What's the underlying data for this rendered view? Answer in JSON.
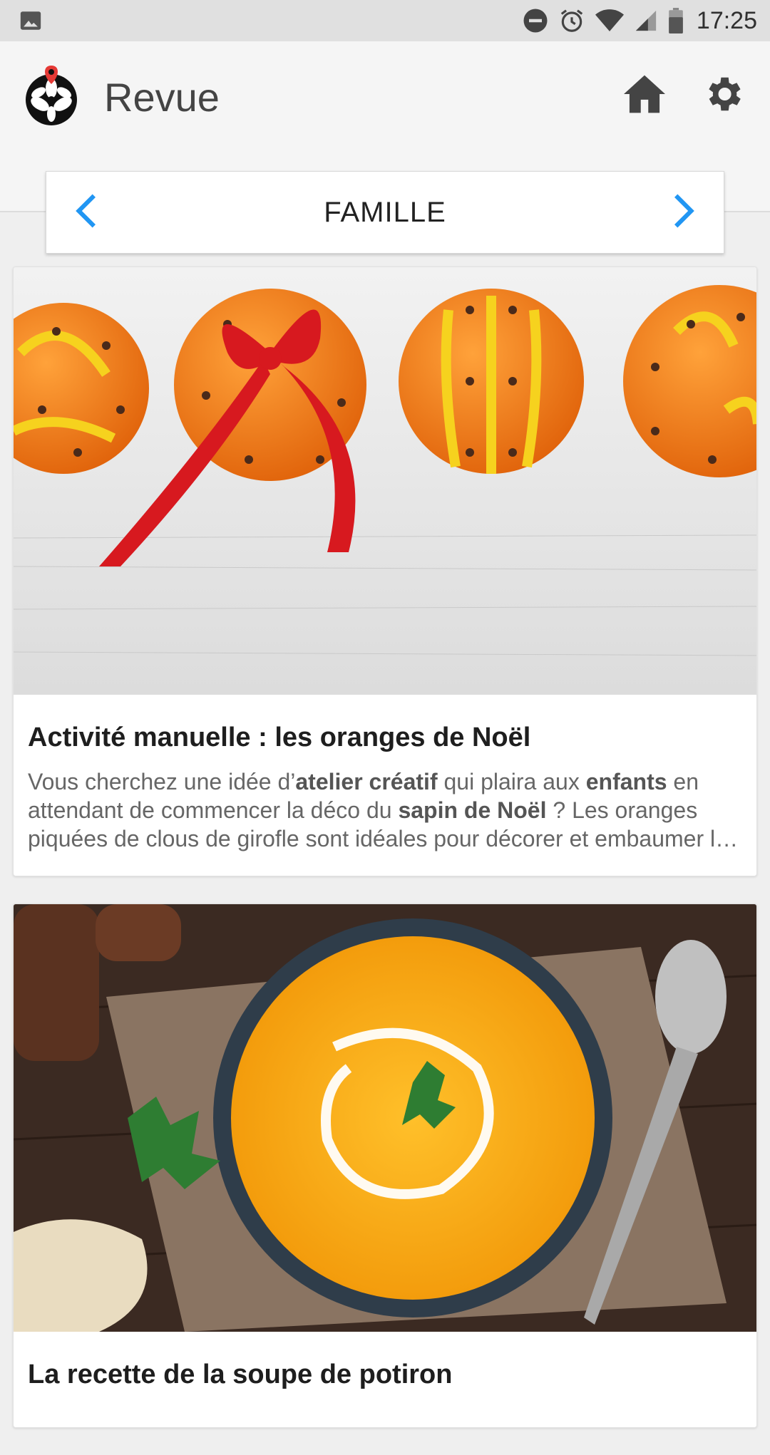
{
  "status_bar": {
    "time": "17:25",
    "icons": [
      "image-notification-icon",
      "do-not-disturb-icon",
      "alarm-icon",
      "wifi-icon",
      "cell-signal-icon",
      "battery-icon"
    ]
  },
  "app_bar": {
    "title": "Revue",
    "logo": "revue-logo",
    "actions": [
      "home-icon",
      "settings-icon"
    ]
  },
  "category": {
    "label": "FAMILLE",
    "prev_icon": "chevron-left-icon",
    "next_icon": "chevron-right-icon",
    "accent_color": "#2196f3"
  },
  "articles": [
    {
      "title": "Activité manuelle : les oranges de Noël",
      "excerpt": [
        {
          "t": "Vous cherchez une idée d’",
          "b": false
        },
        {
          "t": "atelier créatif",
          "b": true
        },
        {
          "t": " qui plaira aux ",
          "b": false
        },
        {
          "t": "enfants",
          "b": true
        },
        {
          "t": " en attendant de commencer la déco du ",
          "b": false
        },
        {
          "t": "sapin de Noël",
          "b": true
        },
        {
          "t": " ? Les oranges piquées de clous de girofle sont idéales pour décorer et embaumer la maison dans les semaines qui précèdent les fêtes…",
          "b": false
        }
      ],
      "image": "clove-studded-oranges-photo"
    },
    {
      "title": "La recette de la soupe de potiron",
      "image": "pumpkin-soup-photo"
    }
  ]
}
